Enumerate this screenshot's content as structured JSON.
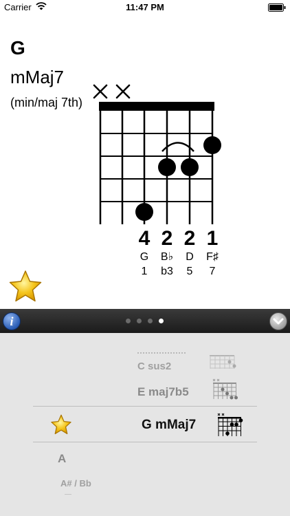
{
  "status_bar": {
    "carrier": "Carrier",
    "time": "11:47 PM"
  },
  "chord": {
    "root": "G",
    "type": "mMaj7",
    "description": "(min/maj 7th)",
    "fingers": [
      "4",
      "2",
      "2",
      "1"
    ],
    "notes": [
      "G",
      "B♭",
      "D",
      "F♯"
    ],
    "intervals": [
      "1",
      "b3",
      "5",
      "7"
    ]
  },
  "toolbar": {
    "info_label": "i",
    "page_count": 4,
    "active_page": 4
  },
  "picker": {
    "chords": [
      "C sus2",
      "E maj7b5",
      "G mMaj7"
    ],
    "selected": "G mMaj7",
    "roots": [
      "A",
      "A# / Bb"
    ]
  },
  "colors": {
    "toolbar": "#262626",
    "picker_bg": "#e5e5e5",
    "accent_info": "#2a5db5",
    "star": "#f5c51d"
  },
  "icons": [
    "wifi-icon",
    "battery-icon",
    "star-icon",
    "info-icon",
    "chevron-down-icon"
  ]
}
